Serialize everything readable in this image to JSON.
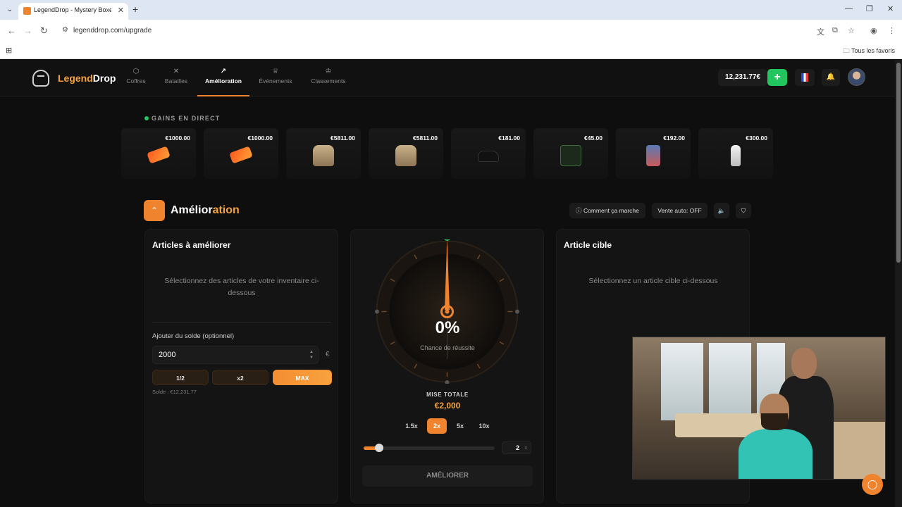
{
  "browser": {
    "tab_title": "LegendDrop - Mystery Boxes &",
    "url": "legenddrop.com/upgrade",
    "favorites_label": "Tous les favoris"
  },
  "nav": {
    "brand_a": "Legend",
    "brand_b": "Drop",
    "items": [
      {
        "label": "Coffres",
        "icon": "box-icon"
      },
      {
        "label": "Batailles",
        "icon": "swords-icon"
      },
      {
        "label": "Amélioration",
        "icon": "trending-up-icon",
        "active": true
      },
      {
        "label": "Événements",
        "icon": "trophy-icon"
      },
      {
        "label": "Classements",
        "icon": "crown-icon"
      }
    ],
    "balance": "12,231.77€",
    "add": "+"
  },
  "live": {
    "title": "GAINS EN DIRECT",
    "drops": [
      {
        "price": "€1000.00",
        "item": "ticket-icon"
      },
      {
        "price": "€1000.00",
        "item": "ticket-icon"
      },
      {
        "price": "€5811.00",
        "item": "jacket-icon"
      },
      {
        "price": "€5811.00",
        "item": "jacket-icon"
      },
      {
        "price": "€181.00",
        "item": "shoe-icon"
      },
      {
        "price": "€45.00",
        "item": "shirt-icon"
      },
      {
        "price": "€192.00",
        "item": "book-icon"
      },
      {
        "price": "€300.00",
        "item": "bottle-icon"
      }
    ]
  },
  "page": {
    "title_a": "Amélior",
    "title_b": "ation",
    "how_it_works": "Comment ça marche",
    "auto_sell": "Vente auto: OFF"
  },
  "left": {
    "title": "Articles à améliorer",
    "empty": "Sélectionnez des articles de votre inventaire ci-dessous",
    "balance_label": "Ajouter du solde (optionnel)",
    "amount": "2000",
    "currency": "€",
    "half": "1/2",
    "double": "x2",
    "max": "MAX",
    "solde": "Solde : €12,231.77"
  },
  "center": {
    "chance": "0%",
    "chance_label": "Chance de réussite",
    "stake_label": "MISE TOTALE",
    "stake": "€2,000",
    "multipliers": [
      "1.5x",
      "2x",
      "5x",
      "10x"
    ],
    "active_multiplier": "2x",
    "multiplier_value": "2",
    "multiplier_suffix": "x",
    "slider_fraction": 0.12,
    "button": "AMÉLIORER"
  },
  "right": {
    "title": "Article cible",
    "empty": "Sélectionnez un article cible ci-dessous"
  },
  "colors": {
    "accent": "#f0832d",
    "success": "#22c55e",
    "background": "#0e0e0e"
  }
}
